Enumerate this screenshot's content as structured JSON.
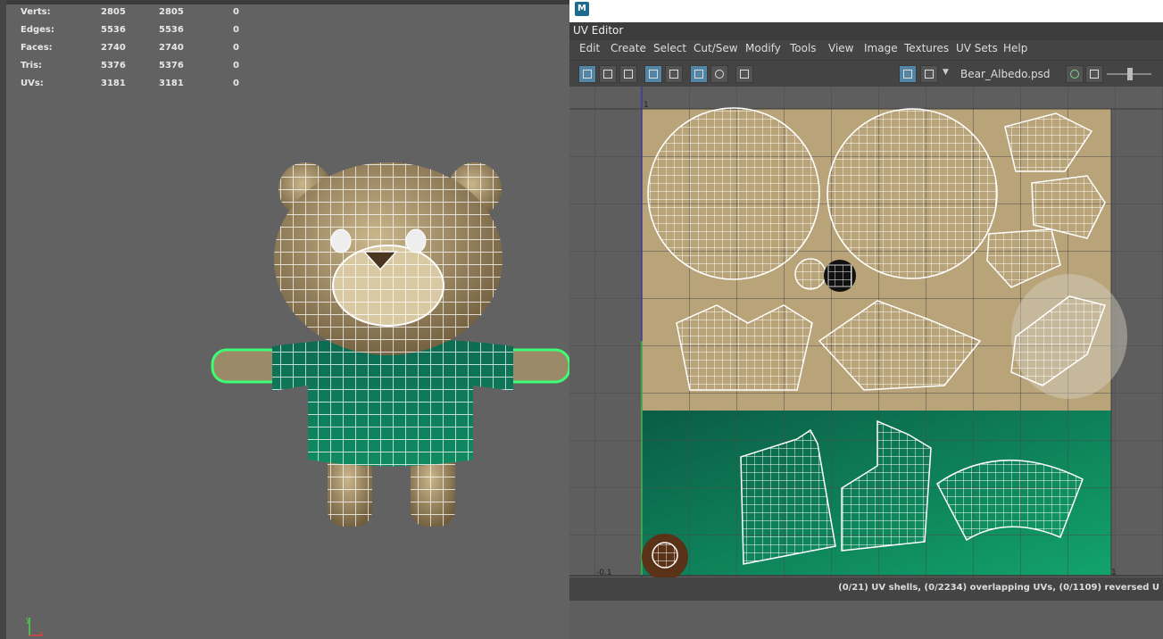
{
  "stats": [
    {
      "label": "Verts:",
      "v1": "2805",
      "v2": "2805",
      "v3": "0"
    },
    {
      "label": "Edges:",
      "v1": "5536",
      "v2": "5536",
      "v3": "0"
    },
    {
      "label": "Faces:",
      "v1": "2740",
      "v2": "2740",
      "v3": "0"
    },
    {
      "label": "Tris:",
      "v1": "5376",
      "v2": "5376",
      "v3": "0"
    },
    {
      "label": "UVs:",
      "v1": "3181",
      "v2": "3181",
      "v3": "0"
    }
  ],
  "viewport": {
    "axis_y": "y",
    "axis_x": "x"
  },
  "uv_editor": {
    "app_icon": "M",
    "tab_title": "UV Editor",
    "menu": [
      "Edit",
      "Create",
      "Select",
      "Cut/Sew",
      "Modify",
      "Tools",
      "View",
      "Image",
      "Textures",
      "UV Sets",
      "Help"
    ],
    "texture_name": "Bear_Albedo.psd",
    "axis_labels": {
      "neg": "-0.1",
      "top_one": "1",
      "right_one": "1"
    },
    "status": "(0/21) UV shells, (0/2234) overlapping UVs, (0/1109) reversed U"
  },
  "colors": {
    "fur": "#b9a47a",
    "shirt": "#0e8a62",
    "selection": "#3dff73"
  }
}
